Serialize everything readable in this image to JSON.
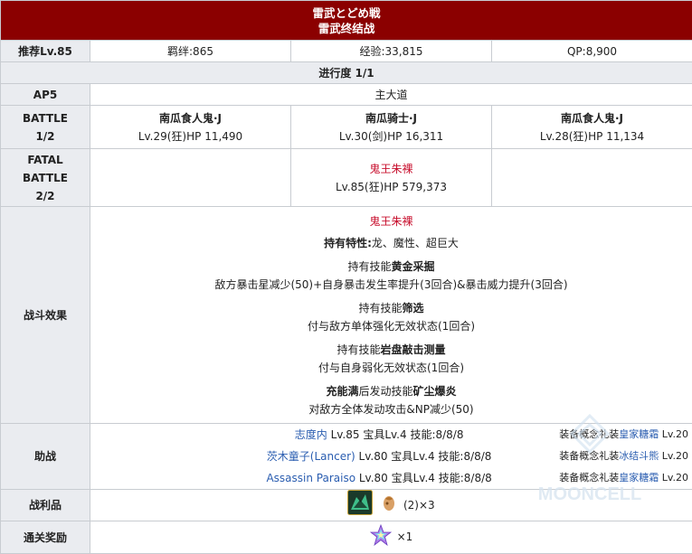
{
  "header": {
    "title_jp": "雷武とどめ戦",
    "title_cn": "雷武终结战"
  },
  "info": {
    "level_label": "推荐Lv.85",
    "bond": "羁绊:865",
    "exp": "经验:33,815",
    "qp": "QP:8,900"
  },
  "progress": "进行度 1/1",
  "ap": {
    "label": "AP5",
    "location": "主大道"
  },
  "battle1": {
    "label_line1": "BATTLE",
    "label_line2": "1/2",
    "enemies": [
      {
        "name": "南瓜食人鬼·J",
        "stats": "Lv.29(狂)HP 11,490"
      },
      {
        "name": "南瓜骑士·J",
        "stats": "Lv.30(剑)HP 16,311"
      },
      {
        "name": "南瓜食人鬼·J",
        "stats": "Lv.28(狂)HP 11,134"
      }
    ]
  },
  "battle2": {
    "label_line1": "FATAL",
    "label_line2": "BATTLE",
    "label_line3": "2/2",
    "boss_name": "鬼王朱裸",
    "boss_stats": "Lv.85(狂)HP 579,373"
  },
  "effects": {
    "label": "战斗效果",
    "boss_name": "鬼王朱裸",
    "traits_label": "持有特性:",
    "traits": "龙、魔性、超巨大",
    "skill1_prefix": "持有技能",
    "skill1_name": "黄金采掘",
    "skill1_desc": "敌方暴击星减少(50)+自身暴击发生率提升(3回合)&暴击威力提升(3回合)",
    "skill2_prefix": "持有技能",
    "skill2_name": "筛选",
    "skill2_desc": "付与敌方单体强化无效状态(1回合)",
    "skill3_prefix": "持有技能",
    "skill3_name": "岩盘敲击测量",
    "skill3_desc": "付与自身弱化无效状态(1回合)",
    "skill4_prefix": "充能满",
    "skill4_mid": "后发动技能",
    "skill4_name": "矿尘爆炎",
    "skill4_desc": "对敌方全体发动攻击&NP减少(50)"
  },
  "support": {
    "label": "助战",
    "rows": [
      {
        "name": "志度内",
        "detail": " Lv.85 宝具Lv.4 技能:8/8/8",
        "ce_prefix": "装备概念礼装",
        "ce_name": "皇家糖霜",
        "ce_lv": " Lv.20"
      },
      {
        "name": "茨木童子(Lancer)",
        "detail": " Lv.80 宝具Lv.4 技能:8/8/8",
        "ce_prefix": "装备概念礼装",
        "ce_name": "冰结斗熊",
        "ce_lv": " Lv.20"
      },
      {
        "name": "Assassin Paraiso",
        "detail": " Lv.80 宝具Lv.4 技能:8/8/8",
        "ce_prefix": "装备概念礼装",
        "ce_name": "皇家糖霜",
        "ce_lv": " Lv.20"
      }
    ]
  },
  "drops": {
    "label": "战利品",
    "count_text": "(2)×3"
  },
  "reward": {
    "label": "通关奖励",
    "count_text": "×1"
  },
  "watermark": "MOONCELL",
  "colors": {
    "header_bg": "#8b0000",
    "label_bg": "#eaecf0",
    "boss": "#c8102e",
    "link": "#2a5db0"
  }
}
